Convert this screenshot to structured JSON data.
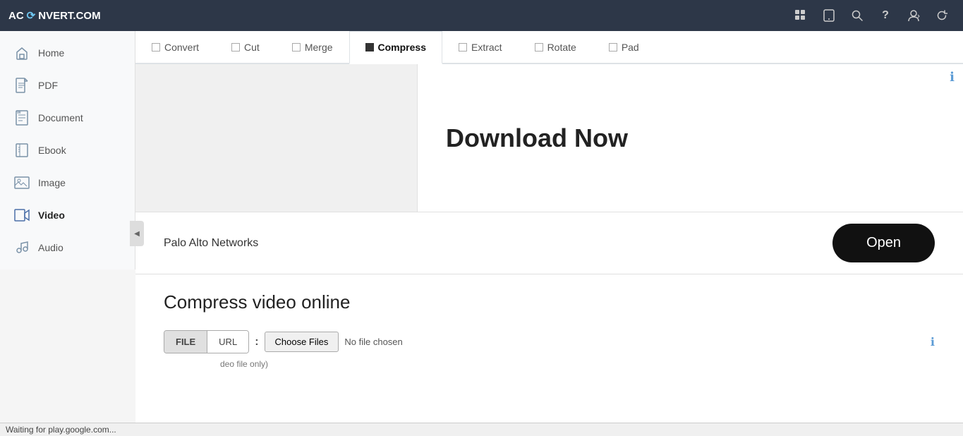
{
  "navbar": {
    "logo_text": "AC",
    "logo_middle": "⟳",
    "logo_rest": "NVERT.COM",
    "icons": {
      "grid": "⊞",
      "tablet": "▭",
      "search": "🔍",
      "help": "?",
      "user": "👤",
      "refresh": "↻"
    }
  },
  "sidebar": {
    "items": [
      {
        "id": "home",
        "label": "Home",
        "icon": "🏠"
      },
      {
        "id": "pdf",
        "label": "PDF",
        "icon": "📄"
      },
      {
        "id": "document",
        "label": "Document",
        "icon": "📝"
      },
      {
        "id": "ebook",
        "label": "Ebook",
        "icon": "📖"
      },
      {
        "id": "image",
        "label": "Image",
        "icon": "🖼"
      },
      {
        "id": "video",
        "label": "Video",
        "icon": "🎬",
        "active": true
      },
      {
        "id": "audio",
        "label": "Audio",
        "icon": "🎵"
      }
    ]
  },
  "tabs": [
    {
      "id": "convert",
      "label": "Convert",
      "active": false,
      "filled": false
    },
    {
      "id": "cut",
      "label": "Cut",
      "active": false,
      "filled": false
    },
    {
      "id": "merge",
      "label": "Merge",
      "active": false,
      "filled": false
    },
    {
      "id": "compress",
      "label": "Compress",
      "active": true,
      "filled": true
    },
    {
      "id": "extract",
      "label": "Extract",
      "active": false,
      "filled": false
    },
    {
      "id": "rotate",
      "label": "Rotate",
      "active": false,
      "filled": false
    },
    {
      "id": "pad",
      "label": "Pad",
      "active": false,
      "filled": false
    }
  ],
  "ad": {
    "title": "Download Now",
    "sponsor": "Palo Alto Networks",
    "open_button": "Open"
  },
  "page": {
    "title": "Compress video online",
    "file_btn": "FILE",
    "url_btn": "URL",
    "choose_files_label": "Choose Files",
    "no_file_label": "No file chosen",
    "file_hint": "deo file only)",
    "info_tooltip": "ℹ"
  },
  "status_bar": {
    "text": "Waiting for play.google.com..."
  }
}
